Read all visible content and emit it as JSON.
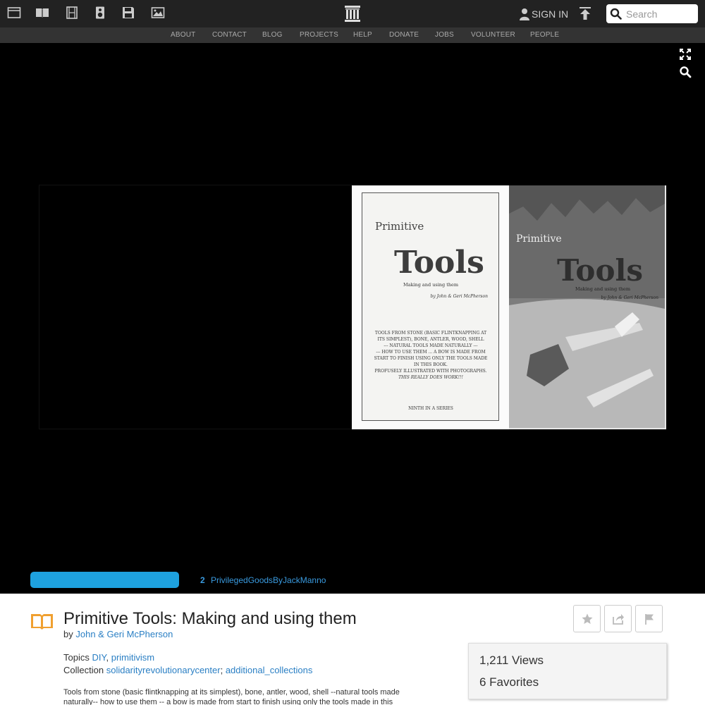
{
  "topbar": {
    "media_icons": [
      "web-icon",
      "texts-icon",
      "video-icon",
      "audio-icon",
      "software-icon",
      "images-icon"
    ],
    "signin_label": "SIGN IN",
    "search_placeholder": "Search"
  },
  "nav": {
    "items": [
      "ABOUT",
      "CONTACT",
      "BLOG",
      "PROJECTS",
      "HELP",
      "DONATE",
      "JOBS",
      "VOLUNTEER",
      "PEOPLE"
    ]
  },
  "viewer": {
    "book_left": {
      "title_top": "Primitive",
      "title_main": "Tools",
      "subtitle": "Making and using them",
      "author": "by John & Geri McPherson",
      "blurb": [
        "TOOLS FROM STONE (BASIC FLINTKNAPPING AT",
        "ITS SIMPLEST), BONE, ANTLER, WOOD, SHELL",
        "--- NATURAL TOOLS MADE NATURALLY ---",
        "--- HOW TO USE THEM ... A BOW IS MADE FROM",
        "START TO FINISH USING ONLY THE TOOLS MADE",
        "IN THIS BOOK.",
        "PROFUSELY ILLUSTRATED WITH PHOTOGRAPHS.",
        "THIS REALLY DOES WORK!!!"
      ],
      "series": "NINTH IN A SERIES"
    },
    "book_right": {
      "title_top": "Primitive",
      "title_main": "Tools",
      "subtitle": "Making and using them",
      "author": "by John & Geri McPherson"
    },
    "page_number": "2",
    "related_link": "PrivilegedGoodsByJackManno"
  },
  "item": {
    "title": "Primitive Tools: Making and using them",
    "by_label": "by",
    "author": "John & Geri McPherson",
    "topics_label": "Topics",
    "topics": [
      "DIY",
      "primitivism"
    ],
    "collection_label": "Collection",
    "collections": [
      "solidarityrevolutionarycenter",
      "additional_collections"
    ],
    "description": "Tools from stone (basic flintknapping at its simplest), bone, antler, wood, shell --natural tools made naturally-- how to use them -- a bow is made from start to finish using only the tools made in this",
    "views": "1,211 Views",
    "favorites": "6 Favorites"
  },
  "colors": {
    "accent": "#1ea1de",
    "link": "#2a7fc4",
    "texts_icon": "#f0a030"
  }
}
